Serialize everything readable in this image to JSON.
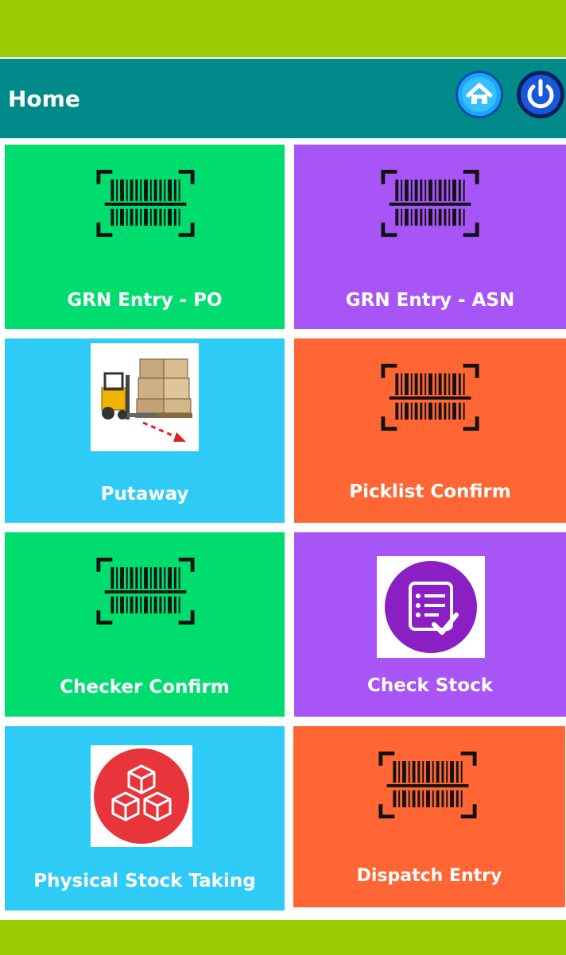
{
  "header": {
    "title": "Home",
    "home_icon": "home-icon",
    "power_icon": "power-icon"
  },
  "colors": {
    "top_bar": "#99cc00",
    "header": "#008a8a",
    "green": "#00dd6f",
    "purple": "#a855f7",
    "blue": "#2ecbf7",
    "orange": "#ff6633"
  },
  "tiles": [
    {
      "label": "GRN Entry - PO",
      "icon": "barcode-scan-icon"
    },
    {
      "label": "GRN Entry - ASN",
      "icon": "barcode-scan-icon"
    },
    {
      "label": "Putaway",
      "icon": "forklift-pallet-icon"
    },
    {
      "label": "Picklist Confirm",
      "icon": "barcode-scan-icon"
    },
    {
      "label": "Checker Confirm",
      "icon": "barcode-scan-icon"
    },
    {
      "label": "Check Stock",
      "icon": "checklist-icon"
    },
    {
      "label": "Physical Stock Taking",
      "icon": "stacked-boxes-icon"
    },
    {
      "label": "Dispatch Entry",
      "icon": "barcode-scan-icon"
    }
  ]
}
